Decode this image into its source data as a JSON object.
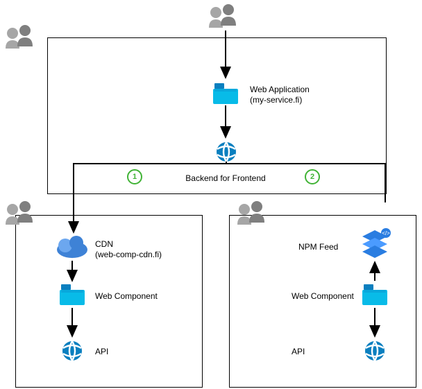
{
  "top_section": {
    "web_application": {
      "title": "Web Application",
      "subtitle": "(my-service.fi)"
    },
    "backend_for_frontend": "Backend for Frontend",
    "badge_left": "1",
    "badge_right": "2"
  },
  "left_branch": {
    "cdn": {
      "title": "CDN",
      "subtitle": "(web-comp-cdn.fi)"
    },
    "web_component": "Web Component",
    "api": "API"
  },
  "right_branch": {
    "npm_feed": "NPM Feed",
    "web_component": "Web Component",
    "api": "API"
  }
}
